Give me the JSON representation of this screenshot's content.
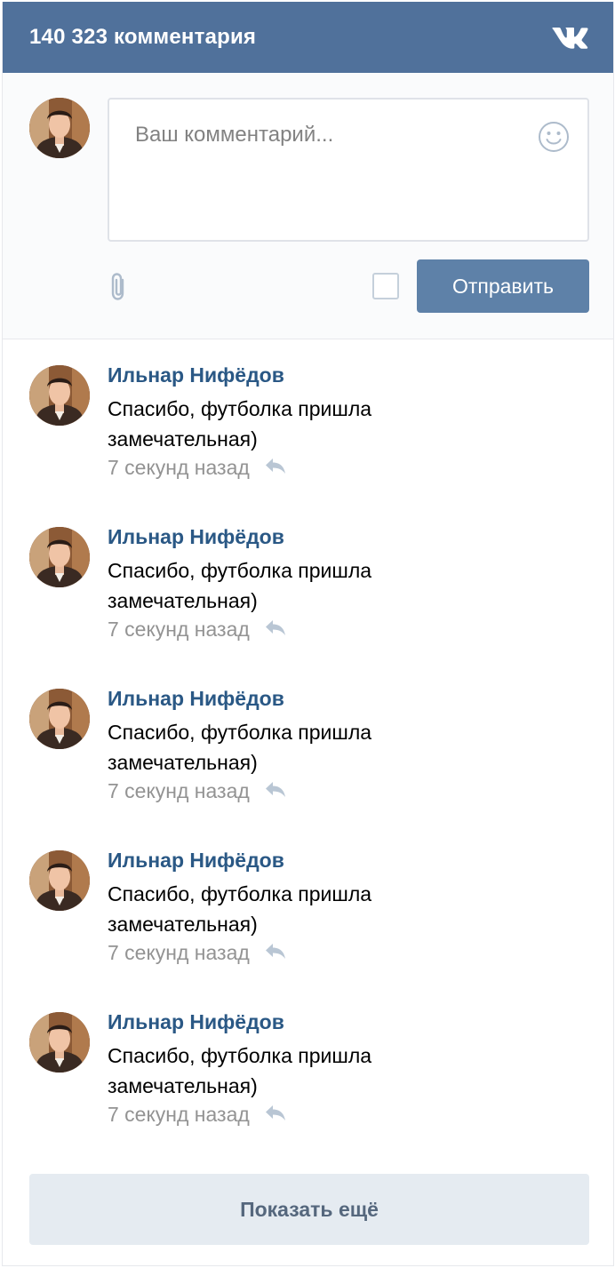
{
  "header": {
    "title": "140 323 комментария",
    "logo_icon": "vk-logo-icon",
    "color": "#50719b"
  },
  "composer": {
    "placeholder": "Ваш комментарий...",
    "send_label": "Отправить",
    "smile_icon": "smile-icon",
    "attach_icon": "paperclip-icon",
    "checkbox_checked": false
  },
  "comments": [
    {
      "author": "Ильнар Нифёдов",
      "text": "Спасибо, футболка пришла замечательная)",
      "time": "7 секунд назад"
    },
    {
      "author": "Ильнар Нифёдов",
      "text": "Спасибо, футболка пришла замечательная)",
      "time": "7 секунд назад"
    },
    {
      "author": "Ильнар Нифёдов",
      "text": "Спасибо, футболка пришла замечательная)",
      "time": "7 секунд назад"
    },
    {
      "author": "Ильнар Нифёдов",
      "text": "Спасибо, футболка пришла замечательная)",
      "time": "7 секунд назад"
    },
    {
      "author": "Ильнар Нифёдов",
      "text": "Спасибо, футболка пришла замечательная)",
      "time": "7 секунд назад"
    }
  ],
  "show_more_label": "Показать ещё",
  "colors": {
    "link": "#2a5885",
    "button": "#5e81a8",
    "muted": "#939393"
  }
}
